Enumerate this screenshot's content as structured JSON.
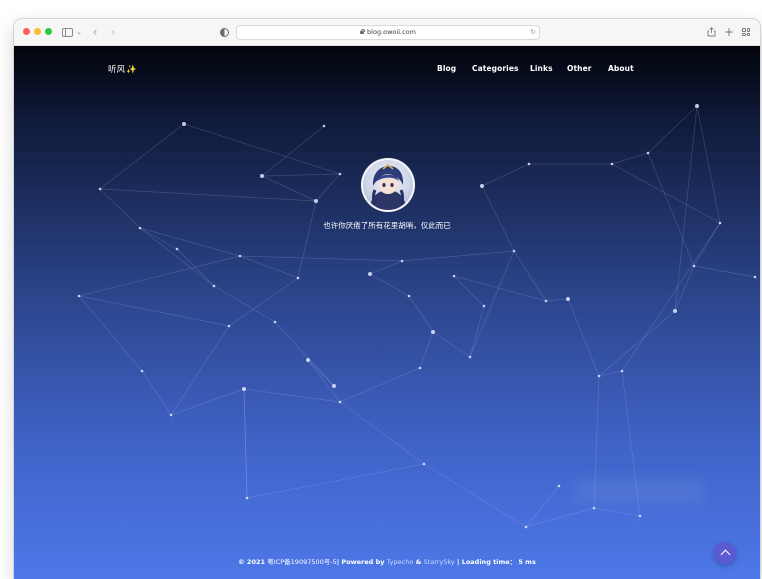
{
  "browser": {
    "url": "blog.owoii.com",
    "icons": [
      "sidebar-icon",
      "chevron-down-icon",
      "back-icon",
      "forward-icon",
      "shield-icon",
      "lock-icon",
      "reload-icon",
      "share-icon",
      "new-tab-icon",
      "tab-overview-icon"
    ]
  },
  "site": {
    "brand": "听风",
    "brand_emoji": "✨",
    "nav": [
      {
        "label": "Blog"
      },
      {
        "label": "Categories"
      },
      {
        "label": "Links"
      },
      {
        "label": "Other"
      },
      {
        "label": "About"
      }
    ],
    "motto": "也许你厌倦了所有花里胡哨，仅此而已"
  },
  "footer": {
    "copyright": "© 2021",
    "icp": "粤ICP备19097500号-5",
    "sep1": "|",
    "powered_prefix": "Powered by",
    "typecho": "Typecho",
    "amp": "&",
    "theme": "StarrySky",
    "sep2": "|",
    "loading_label": "Loading time：",
    "loading_value": "5 ms"
  },
  "colors": {
    "bg_top": "#02040b",
    "bg_bottom": "#4e78e8",
    "back_to_top": "#5a5bd1"
  }
}
